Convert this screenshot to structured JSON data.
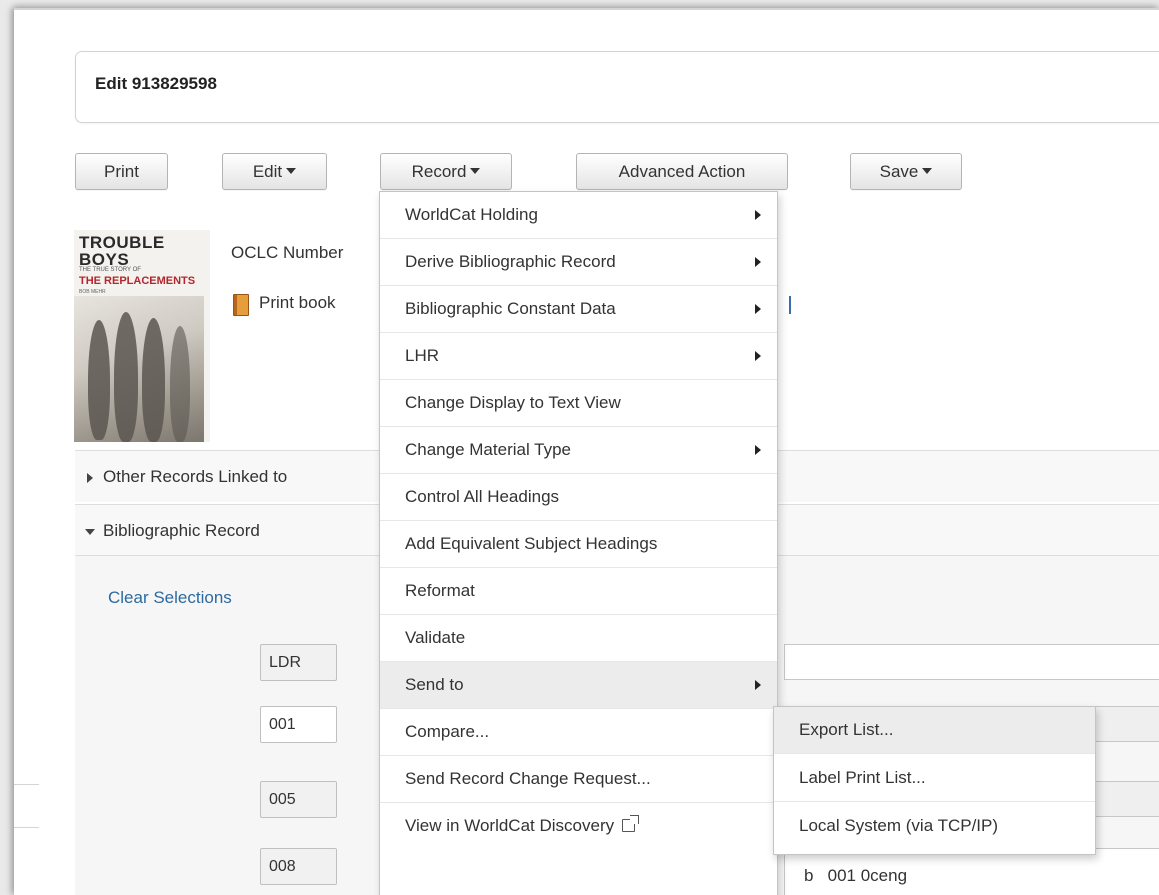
{
  "record": {
    "title": "Edit 913829598"
  },
  "toolbar": {
    "print_label": "Print",
    "edit_label": "Edit",
    "record_label": "Record",
    "advanced_label": "Advanced Action",
    "save_label": "Save"
  },
  "cover": {
    "line1": "TROUBLE",
    "line2": "BOYS",
    "line3": "THE TRUE STORY OF",
    "line4": "THE REPLACEMENTS",
    "line5": "BOB MEHR"
  },
  "meta": {
    "oclc_label": "OCLC Number",
    "type_label": "Print book"
  },
  "sections": {
    "other_records": "Other Records Linked to",
    "bibliographic": "Bibliographic Record",
    "clear_selections": "Clear Selections"
  },
  "fields": {
    "ldr": "LDR",
    "f001": "001",
    "f005": "005",
    "f008": "008",
    "f008_value": "b   001 0ceng"
  },
  "record_menu": {
    "items": [
      {
        "label": "WorldCat Holding",
        "submenu": true
      },
      {
        "label": "Derive Bibliographic Record",
        "submenu": true
      },
      {
        "label": "Bibliographic Constant Data",
        "submenu": true
      },
      {
        "label": "LHR",
        "submenu": true
      },
      {
        "label": "Change Display to Text View",
        "submenu": false
      },
      {
        "label": "Change Material Type",
        "submenu": true
      },
      {
        "label": "Control All Headings",
        "submenu": false
      },
      {
        "label": "Add Equivalent Subject Headings",
        "submenu": false
      },
      {
        "label": "Reformat",
        "submenu": false
      },
      {
        "label": "Validate",
        "submenu": false
      },
      {
        "label": "Send to",
        "submenu": true
      },
      {
        "label": "Compare...",
        "submenu": false
      },
      {
        "label": "Send Record Change Request...",
        "submenu": false
      },
      {
        "label": "View in WorldCat Discovery",
        "submenu": false
      }
    ]
  },
  "send_to_menu": {
    "items": [
      {
        "label": "Export List..."
      },
      {
        "label": "Label Print List..."
      },
      {
        "label": "Local System (via TCP/IP)"
      }
    ]
  },
  "icons": {
    "submenu_arrow": "chevron-right-icon",
    "external_link": "external-link-icon",
    "book": "book-icon"
  },
  "colors": {
    "link": "#2c6aa0",
    "menu_hover": "#ececec",
    "cover_red": "#b3262b"
  }
}
